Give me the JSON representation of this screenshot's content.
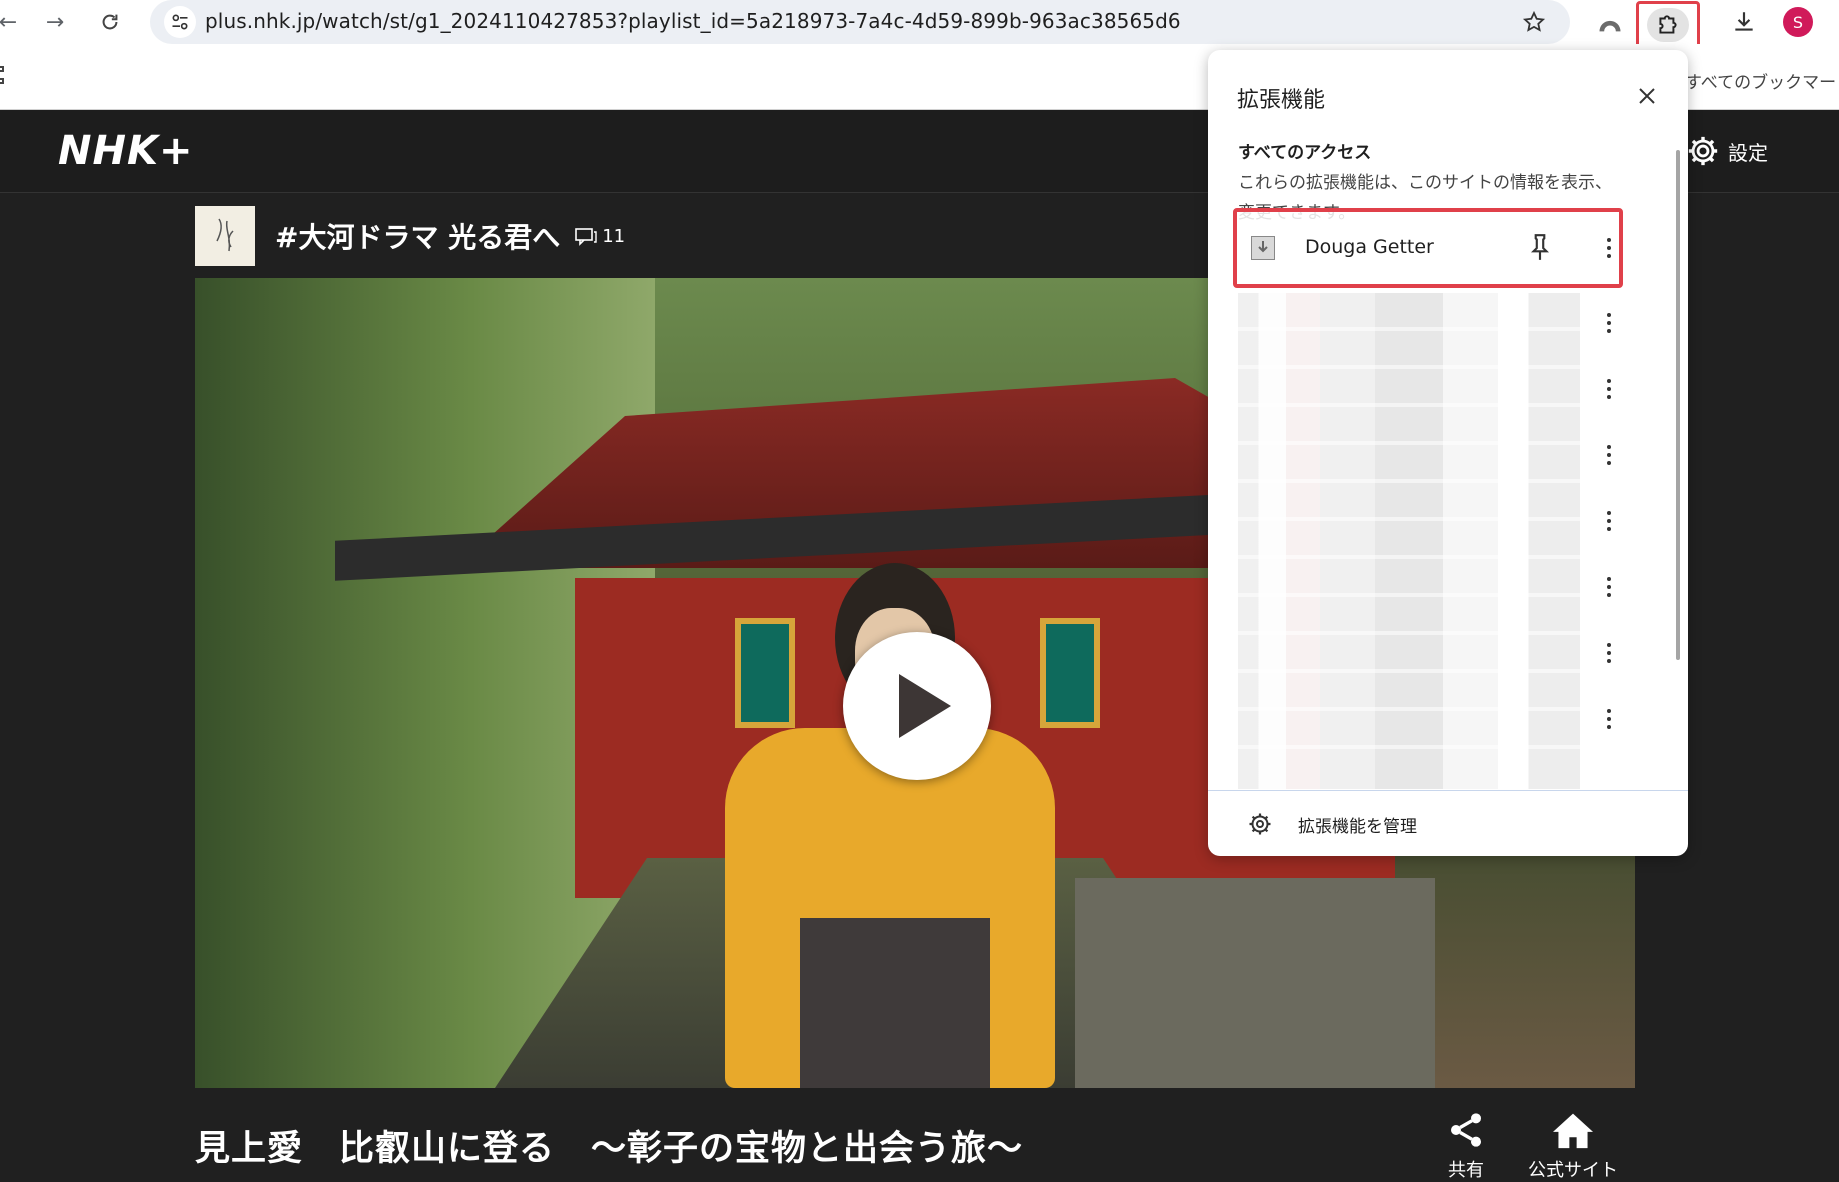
{
  "browser": {
    "url": "plus.nhk.jp/watch/st/g1_2024110427853?playlist_id=5a218973-7a4c-4d59-899b-963ac38565d6",
    "all_bookmarks_label": "すべてのブックマー",
    "avatar_letter": "S",
    "highlight_color": "#e0404a"
  },
  "nhk": {
    "logo": "NHK+",
    "settings_label": "設定",
    "program_title": "#大河ドラマ 光る君へ",
    "comment_count": "11",
    "episode_title": "見上愛　比叡山に登る　～彰子の宝物と出会う旅～",
    "actions": [
      {
        "label": "共有",
        "icon": "share-icon"
      },
      {
        "label": "公式サイト",
        "icon": "home-icon"
      }
    ]
  },
  "extensions_panel": {
    "title": "拡張機能",
    "section_heading": "すべてのアクセス",
    "section_description": "これらの拡張機能は、このサイトの情報を表示、変更できます。",
    "extension_name": "Douga Getter",
    "manage_label": "拡張機能を管理"
  }
}
